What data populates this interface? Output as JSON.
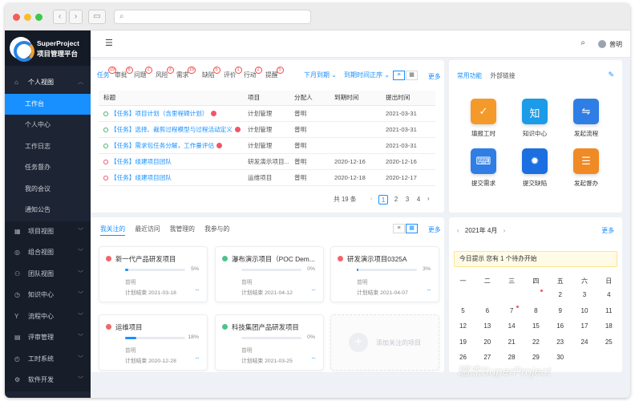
{
  "app": {
    "brand_line1": "SuperProject",
    "brand_line2": "项目管理平台",
    "user": "普明"
  },
  "sidebar": {
    "group_open": "个人视图",
    "sub_items": [
      "工作台",
      "个人中心",
      "工作日志",
      "任务督办",
      "我的会议",
      "通知公告"
    ],
    "groups": [
      "项目视图",
      "组合视图",
      "团队视图",
      "知识中心",
      "流程中心",
      "评审管理",
      "工时系统",
      "软件开发"
    ]
  },
  "tasks": {
    "tabs": [
      {
        "label": "任务",
        "badge": "19"
      },
      {
        "label": "审批",
        "badge": "6"
      },
      {
        "label": "问题",
        "badge": "2"
      },
      {
        "label": "风险",
        "badge": "3"
      },
      {
        "label": "需求",
        "badge": "15"
      },
      {
        "label": "缺陷",
        "badge": "5"
      },
      {
        "label": "评价",
        "badge": "1"
      },
      {
        "label": "行动",
        "badge": "2"
      },
      {
        "label": "提醒",
        "badge": "5"
      }
    ],
    "filter_due": "下月到期",
    "sort": "到期时间正序",
    "more": "更多",
    "columns": [
      "标题",
      "项目",
      "分配人",
      "到期时间",
      "提出时间"
    ],
    "rows": [
      {
        "title": "【任务】项目计划（含里程碑计划）",
        "project": "计划管理",
        "assignee": "普明",
        "due": "",
        "created": "2021-03-31",
        "status": "green",
        "flag": true
      },
      {
        "title": "【任务】选择、裁剪过程模型与过程活动定义",
        "project": "计划管理",
        "assignee": "普明",
        "due": "",
        "created": "2021-03-31",
        "status": "green",
        "flag": true
      },
      {
        "title": "【任务】需求包任务分解，工作量评估",
        "project": "计划管理",
        "assignee": "普明",
        "due": "",
        "created": "2021-03-31",
        "status": "green",
        "flag": true
      },
      {
        "title": "【任务】组建项目团队",
        "project": "研发演示项目...",
        "assignee": "普明",
        "due": "2020-12-16",
        "created": "2020-12-16",
        "status": "red",
        "flag": false
      },
      {
        "title": "【任务】组建项目团队",
        "project": "运维项目",
        "assignee": "普明",
        "due": "2020-12-18",
        "created": "2020-12-17",
        "status": "red",
        "flag": false
      }
    ],
    "total": "共 19 条",
    "pages": [
      "1",
      "2",
      "3",
      "4"
    ]
  },
  "links": {
    "tab_common": "常用功能",
    "tab_external": "外部链接",
    "items": [
      {
        "label": "填报工时",
        "icon": "timesheet-icon",
        "glyph": "✓",
        "color": "#f39a2b"
      },
      {
        "label": "知识中心",
        "icon": "knowledge-icon",
        "glyph": "知",
        "color": "#1b9be8"
      },
      {
        "label": "发起流程",
        "icon": "workflow-icon",
        "glyph": "⇋",
        "color": "#2f7ee6"
      },
      {
        "label": "提交需求",
        "icon": "requirement-icon",
        "glyph": "⌨",
        "color": "#2f7ee6"
      },
      {
        "label": "提交缺陷",
        "icon": "bug-icon",
        "glyph": "✹",
        "color": "#1b6fe0"
      },
      {
        "label": "发起督办",
        "icon": "supervise-icon",
        "glyph": "☰",
        "color": "#f08a24"
      }
    ]
  },
  "projects": {
    "tabs": [
      "我关注的",
      "最近访问",
      "我管理的",
      "我参与的"
    ],
    "more": "更多",
    "cards": [
      {
        "name": "新一代产品研发项目",
        "status_color": "#f0666a",
        "progress": 0.05,
        "pct": "5%",
        "owner": "普明",
        "end": "计划结束 2021-03-18"
      },
      {
        "name": "瀑布演示项目（POC Dem...",
        "status_color": "#4cc38a",
        "progress": 0.0,
        "pct": "0%",
        "owner": "普明",
        "end": "计划结束 2021-04-12"
      },
      {
        "name": "研发演示项目0325A",
        "status_color": "#f0666a",
        "progress": 0.03,
        "pct": "3%",
        "owner": "普明",
        "end": "计划结束 2021-04-07"
      },
      {
        "name": "运维项目",
        "status_color": "#f0666a",
        "progress": 0.18,
        "pct": "18%",
        "owner": "普明",
        "end": "计划结束 2020-12-28"
      },
      {
        "name": "科技集团产品研发项目",
        "status_color": "#4cc38a",
        "progress": 0.0,
        "pct": "0%",
        "owner": "普明",
        "end": "计划结束 2021-03-25"
      }
    ],
    "add_label": "添加关注的项目"
  },
  "calendar": {
    "month": "2021年 4月",
    "more": "更多",
    "notice": "今日提示 您有  1  个待办开始",
    "weekdays": [
      "一",
      "二",
      "三",
      "四",
      "五",
      "六",
      "日"
    ],
    "weeks": [
      [
        "",
        "",
        "",
        "1",
        "2",
        "3",
        "4"
      ],
      [
        "5",
        "6",
        "7",
        "8",
        "9",
        "10",
        "11"
      ],
      [
        "12",
        "13",
        "14",
        "15",
        "16",
        "17",
        "18"
      ],
      [
        "19",
        "20",
        "21",
        "22",
        "23",
        "24",
        "25"
      ],
      [
        "26",
        "27",
        "28",
        "29",
        "30",
        "",
        ""
      ]
    ],
    "today": "1",
    "marked": [
      "1",
      "7"
    ]
  },
  "watermark": "瑞杰SuperProject"
}
